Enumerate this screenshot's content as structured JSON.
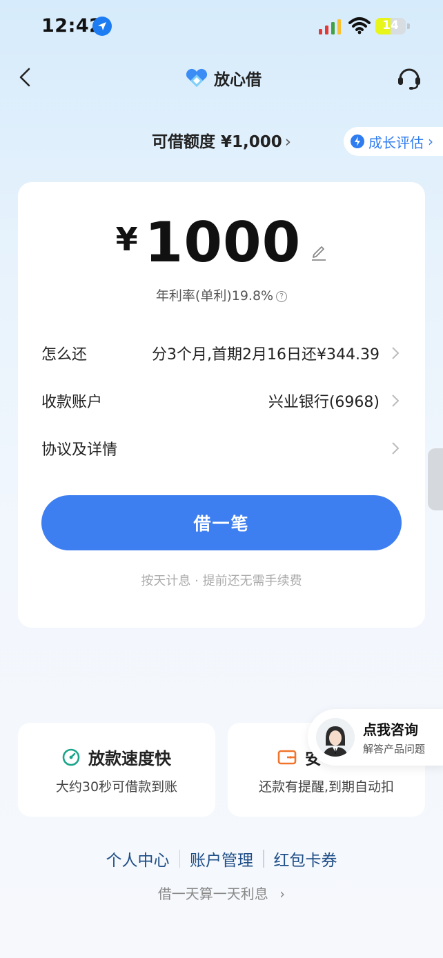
{
  "status_bar": {
    "time": "12:42",
    "battery": "14"
  },
  "header": {
    "brand": "放心借"
  },
  "limit": {
    "label": "可借额度 ¥1,000",
    "growth": "成长评估"
  },
  "loan": {
    "currency": "¥",
    "amount": "1000",
    "rate": "年利率(单利)19.8%",
    "rows": [
      {
        "label": "怎么还",
        "value": "分3个月,首期2月16日还¥344.39"
      },
      {
        "label": "收款账户",
        "value": "兴业银行(6968)"
      },
      {
        "label": "协议及详情",
        "value": ""
      }
    ],
    "borrow_button": "借一笔",
    "note": "按天计息 · 提前还无需手续费"
  },
  "features": [
    {
      "title": "放款速度快",
      "subtitle": "大约30秒可借款到账"
    },
    {
      "title": "安",
      "subtitle": "还款有提醒,到期自动扣"
    }
  ],
  "consult": {
    "title": "点我咨询",
    "subtitle": "解答产品问题"
  },
  "links": [
    "个人中心",
    "账户管理",
    "红包卡券"
  ],
  "promo": "借一天算一天利息",
  "colors": {
    "primary": "#3d7ef0",
    "link": "#1f4e87",
    "feature_icon_speed": "#1aa58a",
    "feature_icon_safe": "#f0742b"
  }
}
